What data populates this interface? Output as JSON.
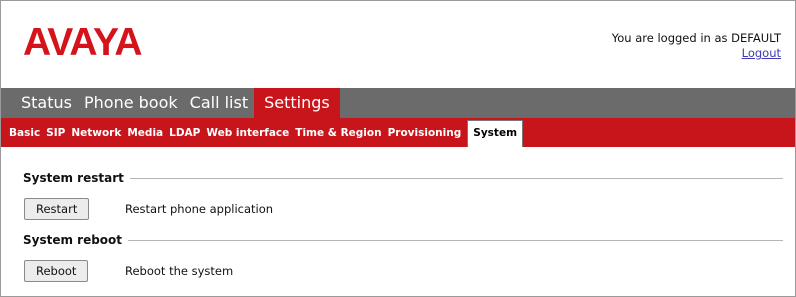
{
  "brand": {
    "logo_text": "AVAYA",
    "color": "#d4131a"
  },
  "session": {
    "logged_in_text": "You are logged in as DEFAULT",
    "logout_label": "Logout"
  },
  "main_nav": {
    "items": [
      "Status",
      "Phone book",
      "Call list",
      "Settings"
    ],
    "active": "Settings"
  },
  "sub_nav": {
    "items": [
      "Basic",
      "SIP",
      "Network",
      "Media",
      "LDAP",
      "Web interface",
      "Time & Region",
      "Provisioning",
      "System"
    ],
    "active": "System"
  },
  "sections": {
    "restart": {
      "title": "System restart",
      "button_label": "Restart",
      "description": "Restart phone application"
    },
    "reboot": {
      "title": "System reboot",
      "button_label": "Reboot",
      "description": "Reboot the system"
    }
  },
  "colors": {
    "nav_gray": "#6b6b6b",
    "accent_red": "#c8141b"
  }
}
